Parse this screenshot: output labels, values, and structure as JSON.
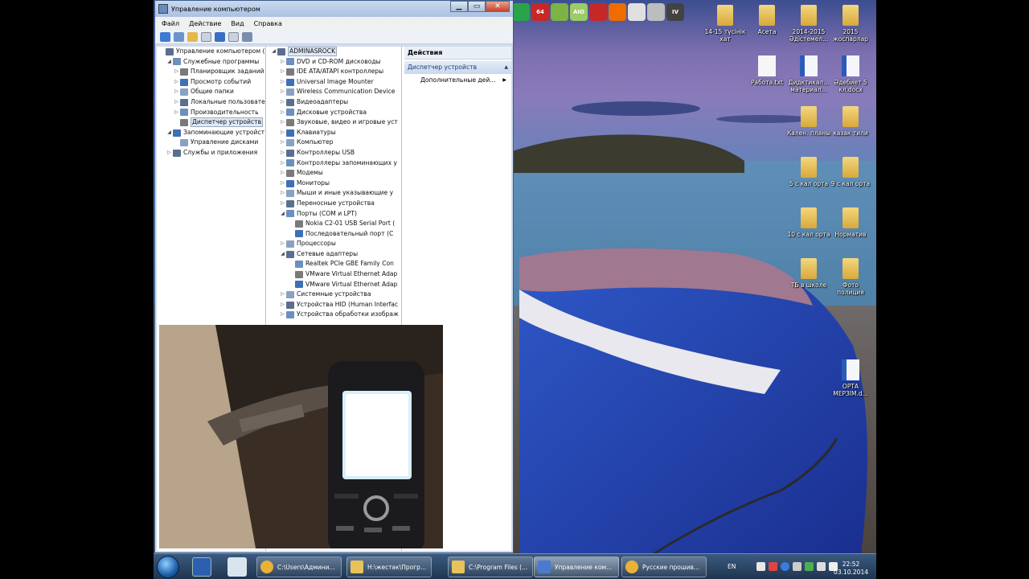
{
  "window": {
    "title": "Управление компьютером",
    "menu": [
      "Файл",
      "Действие",
      "Вид",
      "Справка"
    ],
    "left_tree": [
      {
        "label": "Управление компьютером (л",
        "level": 0,
        "expander": ""
      },
      {
        "label": "Служебные программы",
        "level": 1,
        "expander": "◢"
      },
      {
        "label": "Планировщик заданий",
        "level": 2,
        "expander": "▷"
      },
      {
        "label": "Просмотр событий",
        "level": 2,
        "expander": "▷"
      },
      {
        "label": "Общие папки",
        "level": 2,
        "expander": "▷"
      },
      {
        "label": "Локальные пользовате",
        "level": 2,
        "expander": "▷"
      },
      {
        "label": "Производительность",
        "level": 2,
        "expander": "▷"
      },
      {
        "label": "Диспетчер устройств",
        "level": 2,
        "expander": "",
        "selected": true
      },
      {
        "label": "Запоминающие устройст",
        "level": 1,
        "expander": "◢"
      },
      {
        "label": "Управление дисками",
        "level": 2,
        "expander": ""
      },
      {
        "label": "Службы и приложения",
        "level": 1,
        "expander": "▷"
      }
    ],
    "device_tree": [
      {
        "label": "ADMINASROCK",
        "level": 0,
        "expander": "◢",
        "selected": true
      },
      {
        "label": "DVD и CD-ROM дисководы",
        "level": 1,
        "expander": "▷"
      },
      {
        "label": "IDE ATA/ATAPI контроллеры",
        "level": 1,
        "expander": "▷"
      },
      {
        "label": "Universal Image Mounter",
        "level": 1,
        "expander": "▷"
      },
      {
        "label": "Wireless Communication Device",
        "level": 1,
        "expander": "▷"
      },
      {
        "label": "Видеоадаптеры",
        "level": 1,
        "expander": "▷"
      },
      {
        "label": "Дисковые устройства",
        "level": 1,
        "expander": "▷"
      },
      {
        "label": "Звуковые, видео и игровые уст",
        "level": 1,
        "expander": "▷"
      },
      {
        "label": "Клавиатуры",
        "level": 1,
        "expander": "▷"
      },
      {
        "label": "Компьютер",
        "level": 1,
        "expander": "▷"
      },
      {
        "label": "Контроллеры USB",
        "level": 1,
        "expander": "▷"
      },
      {
        "label": "Контроллеры запоминающих у",
        "level": 1,
        "expander": "▷"
      },
      {
        "label": "Модемы",
        "level": 1,
        "expander": "▷"
      },
      {
        "label": "Мониторы",
        "level": 1,
        "expander": "▷"
      },
      {
        "label": "Мыши и иные указывающие у",
        "level": 1,
        "expander": "▷"
      },
      {
        "label": "Переносные устройства",
        "level": 1,
        "expander": "▷"
      },
      {
        "label": "Порты (COM и LPT)",
        "level": 1,
        "expander": "◢"
      },
      {
        "label": "Nokia C2-01 USB Serial Port (",
        "level": 2,
        "expander": ""
      },
      {
        "label": "Последовательный порт (C",
        "level": 2,
        "expander": ""
      },
      {
        "label": "Процессоры",
        "level": 1,
        "expander": "▷"
      },
      {
        "label": "Сетевые адаптеры",
        "level": 1,
        "expander": "◢"
      },
      {
        "label": "Realtek PCIe GBE Family Con",
        "level": 2,
        "expander": ""
      },
      {
        "label": "VMware Virtual Ethernet Adap",
        "level": 2,
        "expander": ""
      },
      {
        "label": "VMware Virtual Ethernet Adap",
        "level": 2,
        "expander": ""
      },
      {
        "label": "Системные устройства",
        "level": 1,
        "expander": "▷"
      },
      {
        "label": "Устройства HID (Human Interfac",
        "level": 1,
        "expander": "▷"
      },
      {
        "label": "Устройства обработки изображ",
        "level": 1,
        "expander": "▷"
      }
    ],
    "actions": {
      "header": "Действия",
      "section": "Диспетчер устройств",
      "item": "Дополнительные дей..."
    }
  },
  "desktop_icons": [
    {
      "label": "14-15 түсінік хат",
      "col": 0,
      "row": 0,
      "kind": "folder"
    },
    {
      "label": "Асета",
      "col": 1,
      "row": 0,
      "kind": "folder"
    },
    {
      "label": "2014-2015 Әдістемел...",
      "col": 2,
      "row": 0,
      "kind": "folder"
    },
    {
      "label": "2015 жоспарлар",
      "col": 3,
      "row": 0,
      "kind": "folder"
    },
    {
      "label": "Работа.txt",
      "col": 1,
      "row": 1,
      "kind": "file"
    },
    {
      "label": "Дидктикал... материал...",
      "col": 2,
      "row": 1,
      "kind": "word"
    },
    {
      "label": "Әдебиет 5 кл.docx",
      "col": 3,
      "row": 1,
      "kind": "word"
    },
    {
      "label": "Кален. планы",
      "col": 2,
      "row": 2,
      "kind": "folder"
    },
    {
      "label": "казак тили",
      "col": 3,
      "row": 2,
      "kind": "folder"
    },
    {
      "label": "5 с кал орта",
      "col": 2,
      "row": 3,
      "kind": "folder"
    },
    {
      "label": "9 с кал орта",
      "col": 3,
      "row": 3,
      "kind": "folder"
    },
    {
      "label": "10 с кал орта",
      "col": 2,
      "row": 4,
      "kind": "folder"
    },
    {
      "label": "Норматив",
      "col": 3,
      "row": 4,
      "kind": "folder"
    },
    {
      "label": "ТБ в школе",
      "col": 2,
      "row": 5,
      "kind": "folder"
    },
    {
      "label": "Фото полиция",
      "col": 3,
      "row": 5,
      "kind": "folder"
    },
    {
      "label": "ОРТА МЕРЗІМ.d...",
      "col": 3,
      "row": 7,
      "kind": "word"
    }
  ],
  "quick_launch_colors": [
    "#2aa34a",
    "#c62828",
    "#7cb342",
    "#9ccc65",
    "#c62828",
    "#ef6c00",
    "#e0e0e0",
    "#bdbdbd",
    "#424242"
  ],
  "quick_launch_labels": [
    "64",
    "AIO",
    "IV"
  ],
  "taskbar": {
    "tasks": [
      {
        "label": "C:\\Users\\Админи...",
        "icon": "chrome"
      },
      {
        "label": "H:\\жестак\\Прогр...",
        "icon": "folder"
      },
      {
        "label": "C:\\Program Files (...",
        "icon": "folder"
      },
      {
        "label": "Управление ком...",
        "icon": "mmc",
        "active": true
      },
      {
        "label": "Русские прошив...",
        "icon": "chrome"
      }
    ],
    "language": "EN",
    "time": "22:52",
    "date": "03.10.2014"
  },
  "colors": {
    "selection": "#dfe8f6",
    "taskbar": "#2b4668",
    "folder": "#e8c35a"
  }
}
